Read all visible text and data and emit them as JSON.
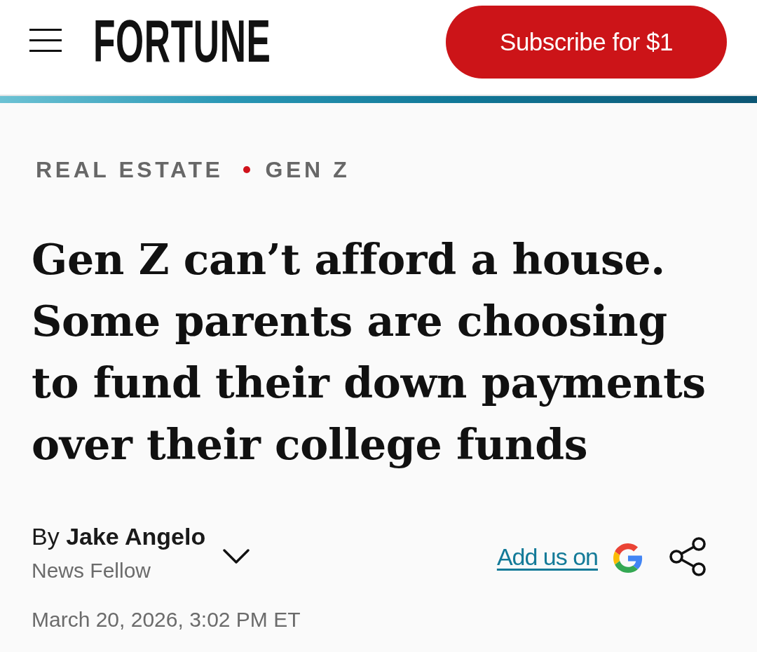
{
  "header": {
    "logo": "FORTUNE",
    "subscribe_button": "Subscribe for $1"
  },
  "breadcrumb": [
    "REAL ESTATE",
    "GEN Z"
  ],
  "headline": "Gen Z can’t afford a house. Some parents are choosing to fund their down payments over their college funds",
  "byline": {
    "author": "By **Jake Angelo**",
    "role": "News Fellow",
    "expanded": false
  },
  "follow": {
    "link": "Add us on"
  },
  "date": "March 20, 2026, 3:02 PM ET"
}
